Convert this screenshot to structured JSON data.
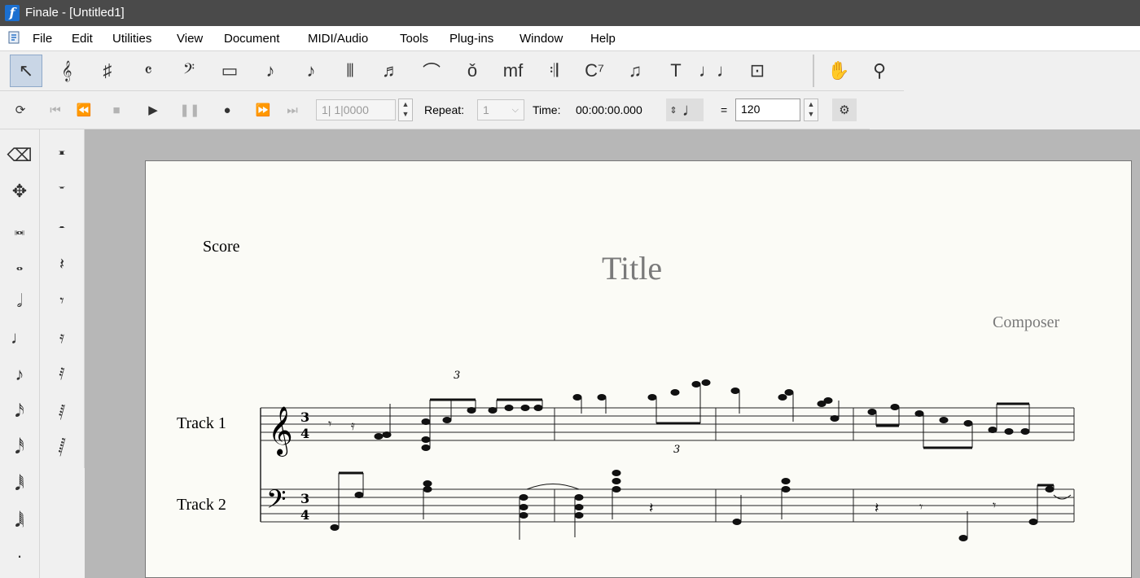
{
  "window": {
    "title": "Finale - [Untitled1]",
    "app_icon_glyph": "f"
  },
  "menu": [
    "File",
    "Edit",
    "Utilities",
    "View",
    "Document",
    "MIDI/Audio",
    "Tools",
    "Plug-ins",
    "Window",
    "Help"
  ],
  "main_tools": [
    {
      "name": "selection-tool-icon",
      "glyph": "↖",
      "selected": true
    },
    {
      "name": "staff-tool-icon",
      "glyph": "𝄞"
    },
    {
      "name": "key-signature-tool-icon",
      "glyph": "♯"
    },
    {
      "name": "time-signature-tool-icon",
      "glyph": "𝄴"
    },
    {
      "name": "clef-tool-icon",
      "glyph": "𝄢"
    },
    {
      "name": "measure-tool-icon",
      "glyph": "▭"
    },
    {
      "name": "simple-entry-tool-icon",
      "glyph": "♪"
    },
    {
      "name": "speedy-entry-tool-icon",
      "glyph": "♪"
    },
    {
      "name": "tuplet-tool-icon",
      "glyph": "⫴"
    },
    {
      "name": "articulation-tool-icon",
      "glyph": "♬"
    },
    {
      "name": "smart-shape-tool-icon",
      "glyph": "⌒"
    },
    {
      "name": "expression-tool-icon",
      "glyph": "ǒ"
    },
    {
      "name": "dynamics-tool-icon",
      "glyph": "mf"
    },
    {
      "name": "repeat-tool-icon",
      "glyph": "𝄇"
    },
    {
      "name": "chord-tool-icon",
      "glyph": "C⁷"
    },
    {
      "name": "lyrics-tool-icon",
      "glyph": "♫"
    },
    {
      "name": "text-tool-icon",
      "glyph": "T"
    },
    {
      "name": "special-tools-icon",
      "glyph": "♩♩"
    },
    {
      "name": "page-layout-tool-icon",
      "glyph": "⊡"
    },
    {
      "name": "hand-grabber-tool-icon",
      "glyph": "✋"
    },
    {
      "name": "zoom-tool-icon",
      "glyph": "⚲"
    }
  ],
  "playback": {
    "measure_counter": "1| 1|0000",
    "repeat_label": "Repeat:",
    "repeat_value": "1",
    "time_label": "Time:",
    "time_value": "00:00:00.000",
    "tempo_equals": "=",
    "tempo_value": "120"
  },
  "score": {
    "header": "Score",
    "title": "Title",
    "composer": "Composer",
    "tracks": [
      "Track 1",
      "Track 2"
    ],
    "tuplet_labels": [
      "3",
      "3"
    ]
  }
}
